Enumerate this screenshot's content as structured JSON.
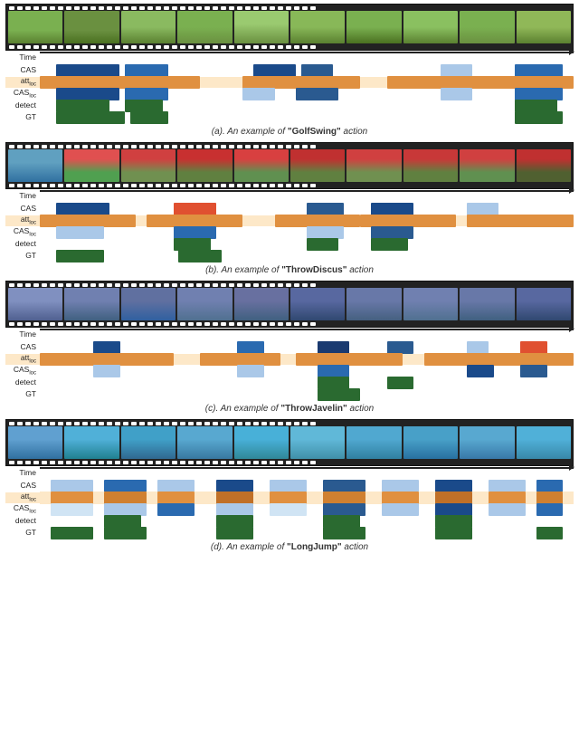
{
  "examples": [
    {
      "id": "golf",
      "caption_label": "(a). An example of ",
      "caption_action": "\"GolfSwing\"",
      "caption_suffix": " action",
      "frame_class": "golf",
      "rows": {
        "time_label": "Time",
        "cas_label": "CAS",
        "att_label": "att",
        "att_sub": "loc",
        "cas2_label": "CAS",
        "cas2_sub": "loc",
        "detect_label": "detect",
        "gt_label": "GT"
      },
      "cas_segments": [
        {
          "left": "3%",
          "width": "12%",
          "color": "#1a4a8a"
        },
        {
          "left": "16%",
          "width": "8%",
          "color": "#2a6ab0"
        },
        {
          "left": "40%",
          "width": "8%",
          "color": "#1a4a8a"
        },
        {
          "left": "49%",
          "width": "6%",
          "color": "#2a5a90"
        },
        {
          "left": "75%",
          "width": "6%",
          "color": "#aac8e8"
        },
        {
          "left": "89%",
          "width": "9%",
          "color": "#2a6ab0"
        }
      ],
      "att_segments": [
        {
          "left": "0%",
          "width": "30%",
          "color": "#e09040"
        },
        {
          "left": "38%",
          "width": "22%",
          "color": "#e09040"
        },
        {
          "left": "65%",
          "width": "35%",
          "color": "#e09040"
        }
      ],
      "cas2_segments": [
        {
          "left": "3%",
          "width": "12%",
          "color": "#1a4a8a"
        },
        {
          "left": "16%",
          "width": "8%",
          "color": "#2a6ab0"
        },
        {
          "left": "38%",
          "width": "6%",
          "color": "#aac8e8"
        },
        {
          "left": "48%",
          "width": "8%",
          "color": "#2a5a90"
        },
        {
          "left": "75%",
          "width": "6%",
          "color": "#aac8e8"
        },
        {
          "left": "89%",
          "width": "9%",
          "color": "#2a6ab0"
        }
      ],
      "detect_segments": [
        {
          "left": "3%",
          "width": "10%",
          "color": "#2a6a30"
        },
        {
          "left": "16%",
          "width": "7%",
          "color": "#2a6a30"
        },
        {
          "left": "89%",
          "width": "8%",
          "color": "#2a6a30"
        }
      ],
      "gt_segments": [
        {
          "left": "3%",
          "width": "13%",
          "color": "#2a6a30"
        },
        {
          "left": "17%",
          "width": "7%",
          "color": "#2a6a30"
        },
        {
          "left": "89%",
          "width": "9%",
          "color": "#2a6a30"
        }
      ]
    },
    {
      "id": "throwdiscus",
      "caption_label": "(b). An example of ",
      "caption_action": "\"ThrowDiscus\"",
      "caption_suffix": " action",
      "frame_class": "throw",
      "rows": {},
      "cas_segments": [
        {
          "left": "3%",
          "width": "10%",
          "color": "#1a4a8a"
        },
        {
          "left": "25%",
          "width": "8%",
          "color": "#e05030"
        },
        {
          "left": "50%",
          "width": "7%",
          "color": "#2a5a90"
        },
        {
          "left": "62%",
          "width": "8%",
          "color": "#1a4a8a"
        },
        {
          "left": "80%",
          "width": "6%",
          "color": "#aac8e8"
        }
      ],
      "att_segments": [
        {
          "left": "0%",
          "width": "18%",
          "color": "#e09040"
        },
        {
          "left": "20%",
          "width": "18%",
          "color": "#e09040"
        },
        {
          "left": "44%",
          "width": "16%",
          "color": "#e09040"
        },
        {
          "left": "60%",
          "width": "18%",
          "color": "#e09040"
        },
        {
          "left": "80%",
          "width": "20%",
          "color": "#e09040"
        }
      ],
      "cas2_segments": [
        {
          "left": "3%",
          "width": "9%",
          "color": "#aac8e8"
        },
        {
          "left": "25%",
          "width": "8%",
          "color": "#2a6ab0"
        },
        {
          "left": "50%",
          "width": "7%",
          "color": "#aac8e8"
        },
        {
          "left": "62%",
          "width": "8%",
          "color": "#2a5a90"
        }
      ],
      "detect_segments": [
        {
          "left": "25%",
          "width": "7%",
          "color": "#2a6a30"
        },
        {
          "left": "50%",
          "width": "6%",
          "color": "#2a6a30"
        },
        {
          "left": "62%",
          "width": "7%",
          "color": "#2a6a30"
        }
      ],
      "gt_segments": [
        {
          "left": "3%",
          "width": "9%",
          "color": "#2a6a30"
        },
        {
          "left": "26%",
          "width": "8%",
          "color": "#2a6a30"
        }
      ]
    },
    {
      "id": "throwjavelin",
      "caption_label": "(c). An example of ",
      "caption_action": "\"ThrowJavelin\"",
      "caption_suffix": " action",
      "frame_class": "javelin",
      "rows": {},
      "cas_segments": [
        {
          "left": "10%",
          "width": "5%",
          "color": "#1a4a8a"
        },
        {
          "left": "37%",
          "width": "5%",
          "color": "#2a6ab0"
        },
        {
          "left": "52%",
          "width": "6%",
          "color": "#1a3a70"
        },
        {
          "left": "65%",
          "width": "5%",
          "color": "#2a5a90"
        },
        {
          "left": "80%",
          "width": "4%",
          "color": "#aac8e8"
        },
        {
          "left": "90%",
          "width": "5%",
          "color": "#e05030"
        }
      ],
      "att_segments": [
        {
          "left": "0%",
          "width": "25%",
          "color": "#e09040"
        },
        {
          "left": "30%",
          "width": "15%",
          "color": "#e09040"
        },
        {
          "left": "48%",
          "width": "20%",
          "color": "#e09040"
        },
        {
          "left": "72%",
          "width": "28%",
          "color": "#e09040"
        }
      ],
      "cas2_segments": [
        {
          "left": "10%",
          "width": "5%",
          "color": "#aac8e8"
        },
        {
          "left": "37%",
          "width": "5%",
          "color": "#aac8e8"
        },
        {
          "left": "52%",
          "width": "6%",
          "color": "#2a6ab0"
        },
        {
          "left": "80%",
          "width": "5%",
          "color": "#1a4a8a"
        },
        {
          "left": "90%",
          "width": "5%",
          "color": "#2a5a90"
        }
      ],
      "detect_segments": [
        {
          "left": "52%",
          "width": "6%",
          "color": "#2a6a30"
        },
        {
          "left": "65%",
          "width": "5%",
          "color": "#2a6a30"
        }
      ],
      "gt_segments": [
        {
          "left": "52%",
          "width": "8%",
          "color": "#2a6a30"
        }
      ]
    },
    {
      "id": "longjump",
      "caption_label": "(d). An example of ",
      "caption_action": "\"LongJump\"",
      "caption_suffix": " action",
      "frame_class": "long",
      "rows": {},
      "cas_segments": [
        {
          "left": "2%",
          "width": "8%",
          "color": "#aac8e8"
        },
        {
          "left": "12%",
          "width": "8%",
          "color": "#2a6ab0"
        },
        {
          "left": "22%",
          "width": "7%",
          "color": "#aac8e8"
        },
        {
          "left": "33%",
          "width": "7%",
          "color": "#1a4a8a"
        },
        {
          "left": "43%",
          "width": "7%",
          "color": "#aac8e8"
        },
        {
          "left": "53%",
          "width": "8%",
          "color": "#2a5a90"
        },
        {
          "left": "64%",
          "width": "7%",
          "color": "#aac8e8"
        },
        {
          "left": "74%",
          "width": "7%",
          "color": "#1a4a8a"
        },
        {
          "left": "84%",
          "width": "7%",
          "color": "#aac8e8"
        },
        {
          "left": "93%",
          "width": "5%",
          "color": "#2a6ab0"
        }
      ],
      "att_segments": [
        {
          "left": "0%",
          "width": "100%",
          "color": "#fde8c8"
        }
      ],
      "att_extra_segments": [
        {
          "left": "2%",
          "width": "8%",
          "color": "#e09040"
        },
        {
          "left": "12%",
          "width": "8%",
          "color": "#d08030"
        },
        {
          "left": "22%",
          "width": "7%",
          "color": "#e09040"
        },
        {
          "left": "33%",
          "width": "7%",
          "color": "#c07028"
        },
        {
          "left": "43%",
          "width": "7%",
          "color": "#e09040"
        },
        {
          "left": "53%",
          "width": "8%",
          "color": "#d08030"
        },
        {
          "left": "64%",
          "width": "7%",
          "color": "#e09040"
        },
        {
          "left": "74%",
          "width": "7%",
          "color": "#c07028"
        },
        {
          "left": "84%",
          "width": "7%",
          "color": "#e09040"
        },
        {
          "left": "93%",
          "width": "5%",
          "color": "#d08030"
        }
      ],
      "cas2_segments": [
        {
          "left": "2%",
          "width": "8%",
          "color": "#d0e4f4"
        },
        {
          "left": "12%",
          "width": "8%",
          "color": "#aac8e8"
        },
        {
          "left": "22%",
          "width": "7%",
          "color": "#2a6ab0"
        },
        {
          "left": "33%",
          "width": "7%",
          "color": "#aac8e8"
        },
        {
          "left": "43%",
          "width": "7%",
          "color": "#d0e4f4"
        },
        {
          "left": "53%",
          "width": "8%",
          "color": "#2a5a90"
        },
        {
          "left": "64%",
          "width": "7%",
          "color": "#aac8e8"
        },
        {
          "left": "74%",
          "width": "7%",
          "color": "#1a4a8a"
        },
        {
          "left": "84%",
          "width": "7%",
          "color": "#aac8e8"
        },
        {
          "left": "93%",
          "width": "5%",
          "color": "#2a6ab0"
        }
      ],
      "detect_segments": [
        {
          "left": "12%",
          "width": "7%",
          "color": "#2a6a30"
        },
        {
          "left": "33%",
          "width": "7%",
          "color": "#2a6a30"
        },
        {
          "left": "53%",
          "width": "7%",
          "color": "#2a6a30"
        },
        {
          "left": "74%",
          "width": "7%",
          "color": "#2a6a30"
        }
      ],
      "gt_segments": [
        {
          "left": "2%",
          "width": "8%",
          "color": "#2a6a30"
        },
        {
          "left": "12%",
          "width": "8%",
          "color": "#2a6a30"
        },
        {
          "left": "33%",
          "width": "7%",
          "color": "#2a6a30"
        },
        {
          "left": "53%",
          "width": "8%",
          "color": "#2a6a30"
        },
        {
          "left": "74%",
          "width": "7%",
          "color": "#2a6a30"
        },
        {
          "left": "93%",
          "width": "5%",
          "color": "#2a6a30"
        }
      ]
    }
  ]
}
